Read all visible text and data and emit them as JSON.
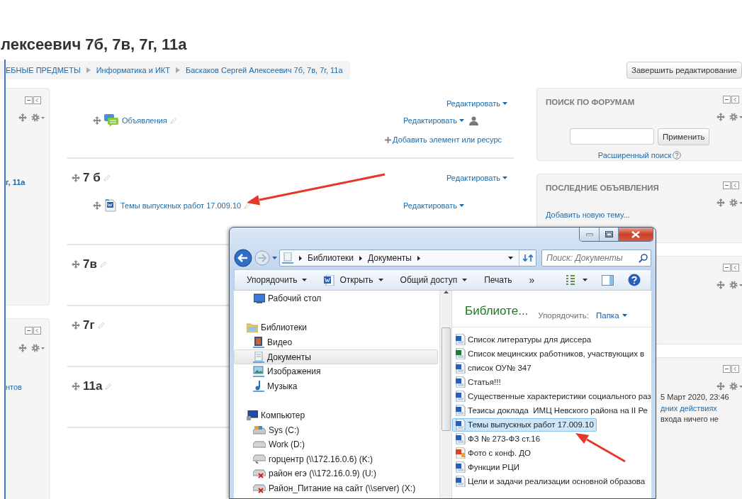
{
  "page_title": "лексеевич 7б, 7в, 7г, 11а",
  "breadcrumb": [
    {
      "label": "ЕБНЫЕ ПРЕДМЕТЫ"
    },
    {
      "label": "Информатика и ИКТ"
    },
    {
      "label": "Баскаков Сергей Алексеевич 7б, 7в, 7г, 11а"
    }
  ],
  "finish_editing_button": "Завершить редактирование",
  "left_blocks": [
    {
      "kind": "title-link",
      "text": "г, 11а"
    },
    {
      "kind": "link",
      "text": "нтов"
    }
  ],
  "intro_section": {
    "edit_link": "Редактировать",
    "items": [
      {
        "kind": "forum",
        "label": "Объявления",
        "edit_link": "Редактировать"
      }
    ],
    "add_link": "Добавить элемент или ресурс"
  },
  "sections": [
    {
      "title": "7 б",
      "edit_link": "Редактировать",
      "items": [
        {
          "kind": "word",
          "label": "Темы выпускных работ 17.009.10",
          "edit_link": "Редактировать"
        }
      ]
    },
    {
      "title": "7в"
    },
    {
      "title": "7г"
    },
    {
      "title": "11а"
    }
  ],
  "right_blocks": [
    {
      "kind": "search",
      "title": "ПОИСК ПО ФОРУМАМ",
      "button": "Применить",
      "link": "Расширенный поиск"
    },
    {
      "kind": "news",
      "title": "ПОСЛЕДНИЕ ОБЪЯВЛЕНИЯ",
      "link": "Добавить новую тему..."
    },
    {
      "kind": "blank"
    },
    {
      "kind": "activity",
      "lines": [
        {
          "text": "5 Март 2020, 23:46",
          "link": false
        },
        {
          "text": "дних действиях",
          "link": true
        },
        {
          "text": "входа ничего не",
          "link": false
        }
      ]
    }
  ],
  "explorer": {
    "address": [
      "Библиотеки",
      "Документы"
    ],
    "search_placeholder": "Поиск: Документы",
    "toolbar": [
      {
        "kind": "menu",
        "label": "Упорядочить"
      },
      {
        "kind": "open",
        "label": "Открыть"
      },
      {
        "kind": "menu",
        "label": "Общий доступ"
      },
      {
        "kind": "plain",
        "label": "Печать"
      },
      {
        "kind": "more",
        "label": "»"
      }
    ],
    "nav": [
      {
        "kind": "desktop",
        "label": "Рабочий стол",
        "selected": false
      },
      {
        "kind": "libraries",
        "label": "Библиотеки",
        "selected": false,
        "children": [
          {
            "kind": "video",
            "label": "Видео",
            "selected": false
          },
          {
            "kind": "documents",
            "label": "Документы",
            "selected": true
          },
          {
            "kind": "pictures",
            "label": "Изображения",
            "selected": false
          },
          {
            "kind": "music",
            "label": "Музыка",
            "selected": false
          }
        ]
      },
      {
        "kind": "computer",
        "label": "Компьютер",
        "selected": false,
        "children": [
          {
            "kind": "system-drive",
            "label": "Sys (C:)",
            "selected": false
          },
          {
            "kind": "drive",
            "label": "Work (D:)",
            "selected": false
          },
          {
            "kind": "network-drive",
            "label": "горцентр (\\\\172.16.0.6) (K:)",
            "selected": false
          },
          {
            "kind": "network-drive-off",
            "label": "район егэ (\\\\172.16.0.9) (U:)",
            "selected": false
          },
          {
            "kind": "network-drive-off",
            "label": "Район_Питание на сайт (\\\\server) (X:)",
            "selected": false
          }
        ]
      }
    ],
    "library_title": "Библиоте...",
    "arrange_label": "Упорядочить:",
    "arrange_value": "Папка",
    "files": [
      {
        "kind": "word",
        "name": "Список литературы для диссера",
        "selected": false
      },
      {
        "kind": "excel",
        "name": "Список мецинских работников, участвующих в",
        "selected": false
      },
      {
        "kind": "word",
        "name": "список ОУ№ 347",
        "selected": false
      },
      {
        "kind": "word",
        "name": "Статья!!!",
        "selected": false
      },
      {
        "kind": "word",
        "name": "Существенные характеристики социального раз",
        "selected": false
      },
      {
        "kind": "word",
        "name": "Тезисы доклада  ИМЦ Невского района на II Ре",
        "selected": false
      },
      {
        "kind": "word",
        "name": "Темы выпускных работ 17.009.10",
        "selected": true
      },
      {
        "kind": "word",
        "name": "ФЗ № 273-ФЗ ст.16",
        "selected": false
      },
      {
        "kind": "image",
        "name": "Фото с конф. ДО",
        "selected": false
      },
      {
        "kind": "word",
        "name": "Функции РЦИ",
        "selected": false
      },
      {
        "kind": "word",
        "name": "Цели и задачи реализации основной образова",
        "selected": false
      }
    ]
  }
}
